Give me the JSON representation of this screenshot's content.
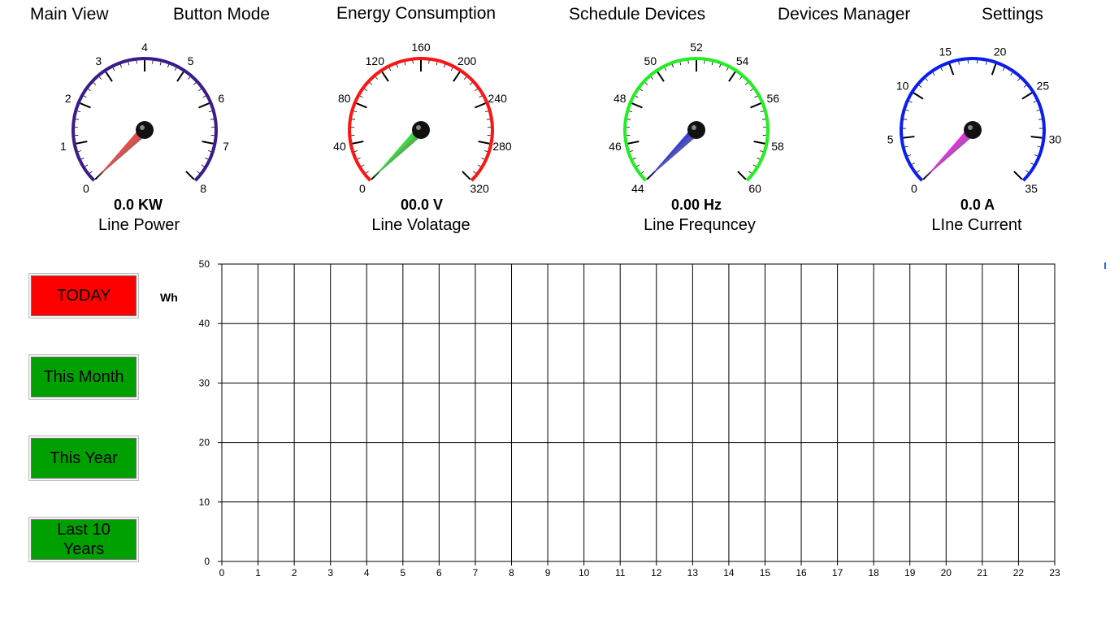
{
  "nav": [
    {
      "label": "Main View",
      "name": "nav-main-view"
    },
    {
      "label": "Button Mode",
      "name": "nav-button-mode"
    },
    {
      "label": "Energy Consumption",
      "name": "nav-energy-consumption"
    },
    {
      "label": "Schedule Devices",
      "name": "nav-schedule-devices"
    },
    {
      "label": "Devices Manager",
      "name": "nav-devices-manager"
    },
    {
      "label": "Settings",
      "name": "nav-settings"
    }
  ],
  "gauges": [
    {
      "name": "line-power",
      "label": "Line Power",
      "value_text": "0.0 KW",
      "value": 0,
      "min": 0,
      "max": 8,
      "major_labels": [
        "0",
        "1",
        "2",
        "3",
        "4",
        "5",
        "6",
        "7",
        "8"
      ],
      "minor_per_major": 5,
      "arc_color": "#3c1b8a",
      "needle_color": "#e94b4b"
    },
    {
      "name": "line-voltage",
      "label": "Line Volatage",
      "value_text": "00.0 V",
      "value": 0,
      "min": 0,
      "max": 320,
      "major_labels": [
        "0",
        "40",
        "80",
        "120",
        "160",
        "200",
        "240",
        "280",
        "320"
      ],
      "minor_per_major": 5,
      "arc_color": "#ff1414",
      "needle_color": "#3fd83f"
    },
    {
      "name": "line-frequency",
      "label": "Line Frequncey",
      "value_text": "0.00 Hz",
      "value": 44,
      "min": 44,
      "max": 60,
      "major_labels": [
        "44",
        "46",
        "48",
        "50",
        "52",
        "54",
        "56",
        "58",
        "60"
      ],
      "minor_per_major": 5,
      "arc_color": "#22ee22",
      "needle_color": "#3a3fd6"
    },
    {
      "name": "line-current",
      "label": "LIne Current",
      "value_text": "0.0 A",
      "value": 0,
      "min": 0,
      "max": 35,
      "major_labels": [
        "0",
        "5",
        "10",
        "15",
        "20",
        "25",
        "30",
        "35"
      ],
      "minor_per_major": 5,
      "arc_color": "#0a1ef0",
      "needle_color": "#dd33dd"
    }
  ],
  "period_buttons": [
    {
      "label": "TODAY",
      "name": "today-button",
      "color": "#ff0000",
      "active": true
    },
    {
      "label": "This Month",
      "name": "this-month-button",
      "color": "#00a000",
      "active": false
    },
    {
      "label": "This Year",
      "name": "this-year-button",
      "color": "#00a000",
      "active": false
    },
    {
      "label": "Last 10 Years",
      "name": "last-10-years-button",
      "color": "#00a000",
      "active": false
    }
  ],
  "chart_unit": "Wh",
  "chart_data": {
    "type": "bar",
    "title": "",
    "xlabel": "",
    "ylabel": "Wh",
    "categories": [
      "0",
      "1",
      "2",
      "3",
      "4",
      "5",
      "6",
      "7",
      "8",
      "9",
      "10",
      "11",
      "12",
      "13",
      "14",
      "15",
      "16",
      "17",
      "18",
      "19",
      "20",
      "21",
      "22",
      "23"
    ],
    "values": [],
    "xlim": [
      0,
      23
    ],
    "ylim": [
      0,
      50
    ],
    "y_ticks": [
      0,
      10,
      20,
      30,
      40,
      50
    ],
    "grid": true,
    "legend": "none"
  }
}
